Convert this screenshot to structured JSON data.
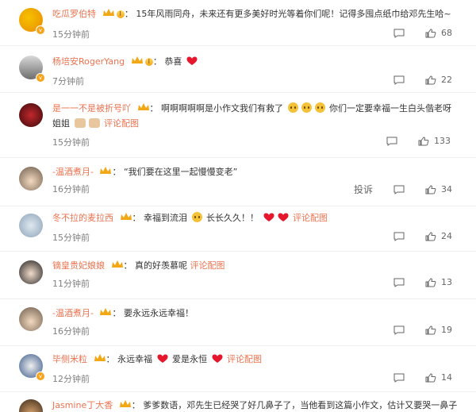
{
  "comments": [
    {
      "name": "吃瓜罗伯特",
      "level": "Ⅰ",
      "text": "15年风雨同舟，未来还有更多美好时光等着你们呢！记得多囤点纸巾给邓先生哈~",
      "time": "15分钟前",
      "likes": "68"
    },
    {
      "name": "杨培安RogerYang",
      "level": "Ⅰ",
      "text": "恭喜",
      "time": "7分钟前",
      "likes": "22"
    },
    {
      "name": "是一一不是被折号吖",
      "text": "啊啊啊啊啊是小作文我们有救了",
      "text2": "你们一定要幸福一生白头偕老呀",
      "text3": "姐姐",
      "link": "评论配图",
      "time": "15分钟前",
      "likes": "133"
    },
    {
      "name": "-温酒煮月-",
      "text": "“我们要在这里一起慢慢变老”",
      "time": "16分钟前",
      "report": "投诉",
      "likes": "34"
    },
    {
      "name": "冬不拉的麦拉西",
      "text": "幸福到流泪",
      "text2": "长长久久！！",
      "link": "评论配图",
      "time": "15分钟前",
      "likes": "24"
    },
    {
      "name": "镝皇贵妃娘娘",
      "text": "真的好羡慕呢",
      "link": "评论配图",
      "time": "11分钟前",
      "likes": "13"
    },
    {
      "name": "-温酒煮月-",
      "text": "要永远永远幸福！",
      "time": "16分钟前",
      "likes": "19"
    },
    {
      "name": "毕侧米粒",
      "text": "永远幸福",
      "text2": "爱是永恒",
      "link": "评论配图",
      "time": "12分钟前",
      "likes": "14"
    },
    {
      "name": "Jasmine丁大香",
      "text": "爹爹数语，邓先生已经哭了好几鼻子了，当他看到这篇小作文，估计又要哭一鼻子"
    }
  ],
  "colors": {
    "name": "#eb7350",
    "link": "#eb7350",
    "time": "#808080",
    "heart": "#e6162d",
    "crown": "#f2a715"
  },
  "icons": {
    "comment": "comment-icon",
    "like": "like-thumb-icon",
    "heart": "red-heart-icon",
    "crown": "crown-icon",
    "verified": "verified-badge-icon"
  }
}
